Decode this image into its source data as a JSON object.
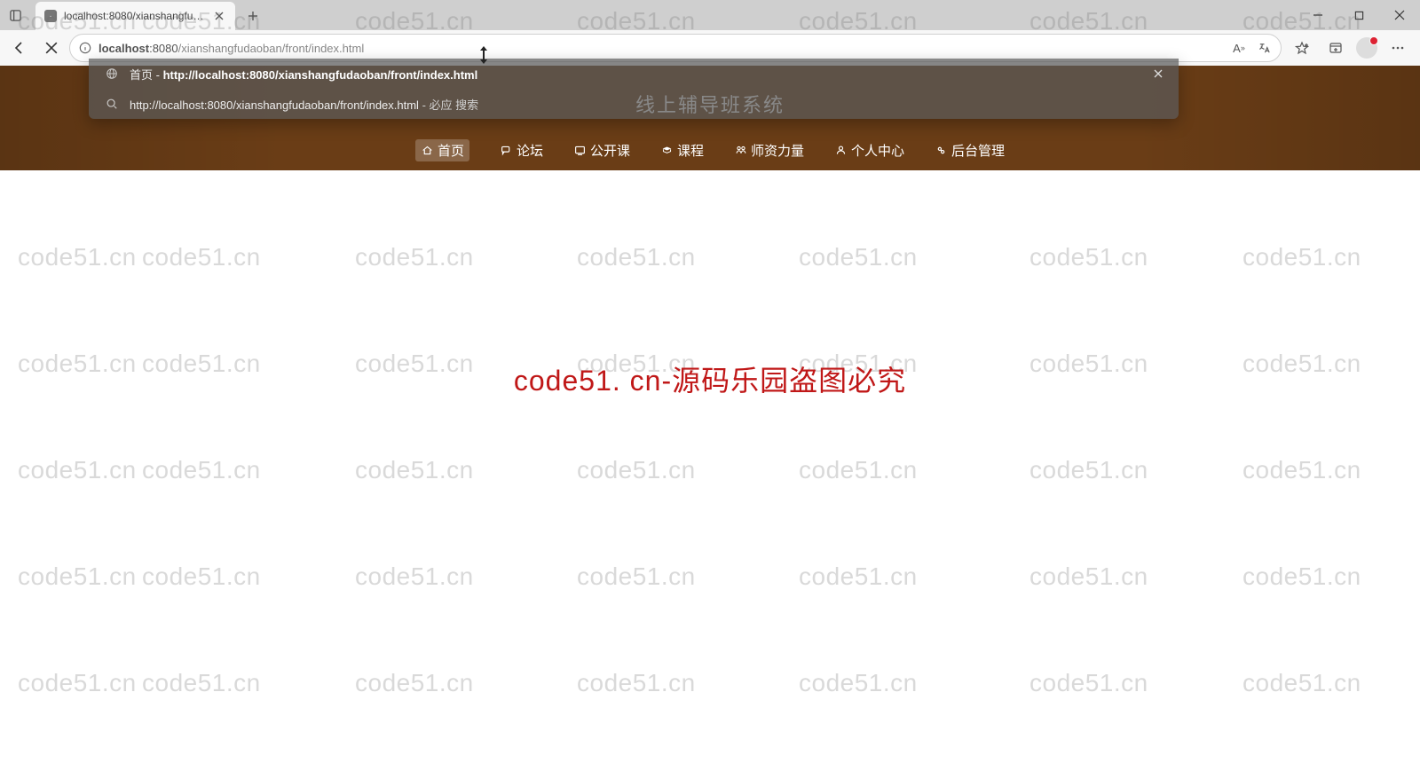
{
  "browser": {
    "tab": {
      "title": "localhost:8080/xianshangfudaob"
    },
    "url": {
      "host": "localhost",
      "port": ":8080",
      "path": "/xianshangfudaoban/front/index.html"
    },
    "suggestions": [
      {
        "kind": "history",
        "title": "首页",
        "sep": " - ",
        "url": "http://localhost:8080/xianshangfudaoban/front/index.html"
      },
      {
        "kind": "search",
        "text": "http://localhost:8080/xianshangfudaoban/front/index.html",
        "hint_sep": " - ",
        "hint": "必应 搜索"
      }
    ]
  },
  "page": {
    "hero_title": "线上辅导班系统",
    "nav": [
      {
        "icon": "home",
        "label": "首页",
        "active": true
      },
      {
        "icon": "forum",
        "label": "论坛"
      },
      {
        "icon": "class",
        "label": "公开课"
      },
      {
        "icon": "course",
        "label": "课程"
      },
      {
        "icon": "teacher",
        "label": "师资力量"
      },
      {
        "icon": "user",
        "label": "个人中心"
      },
      {
        "icon": "admin",
        "label": "后台管理"
      }
    ],
    "center_msg": "code51. cn-源码乐园盗图必究",
    "watermark_text": "code51.cn"
  }
}
